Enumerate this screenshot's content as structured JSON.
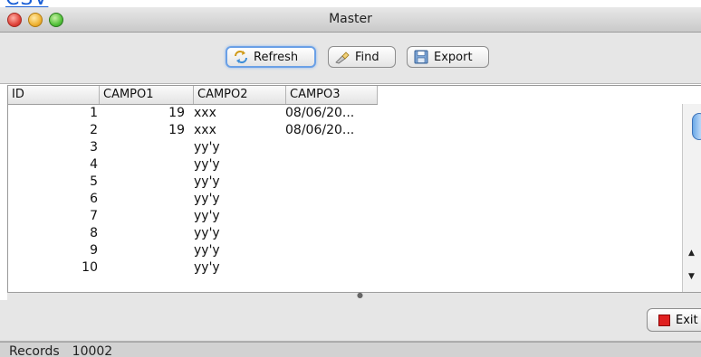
{
  "window": {
    "title": "Master"
  },
  "toolbar": {
    "refresh_label": "Refresh",
    "find_label": "Find",
    "export_label": "Export",
    "icons": {
      "refresh": "refresh-icon",
      "find": "flashlight-icon",
      "export": "floppy-disk-icon"
    }
  },
  "table": {
    "columns": [
      "ID",
      "CAMPO1",
      "CAMPO2",
      "CAMPO3"
    ],
    "rows": [
      {
        "id": "1",
        "campo1": "19",
        "campo2": "xxx",
        "campo3": "08/06/20..."
      },
      {
        "id": "2",
        "campo1": "19",
        "campo2": "xxx",
        "campo3": "08/06/20..."
      },
      {
        "id": "3",
        "campo1": "",
        "campo2": "yy'y",
        "campo3": ""
      },
      {
        "id": "4",
        "campo1": "",
        "campo2": "yy'y",
        "campo3": ""
      },
      {
        "id": "5",
        "campo1": "",
        "campo2": "yy'y",
        "campo3": ""
      },
      {
        "id": "6",
        "campo1": "",
        "campo2": "yy'y",
        "campo3": ""
      },
      {
        "id": "7",
        "campo1": "",
        "campo2": "yy'y",
        "campo3": ""
      },
      {
        "id": "8",
        "campo1": "",
        "campo2": "yy'y",
        "campo3": ""
      },
      {
        "id": "9",
        "campo1": "",
        "campo2": "yy'y",
        "campo3": ""
      },
      {
        "id": "10",
        "campo1": "",
        "campo2": "yy'y",
        "campo3": ""
      }
    ]
  },
  "footer": {
    "exit_label": "Exit"
  },
  "status": {
    "label": "Records",
    "count": "10002"
  },
  "colors": {
    "focus_ring": "#6aa0e6",
    "exit_icon": "#e02020",
    "scroll_thumb": "#6aa8e8"
  }
}
